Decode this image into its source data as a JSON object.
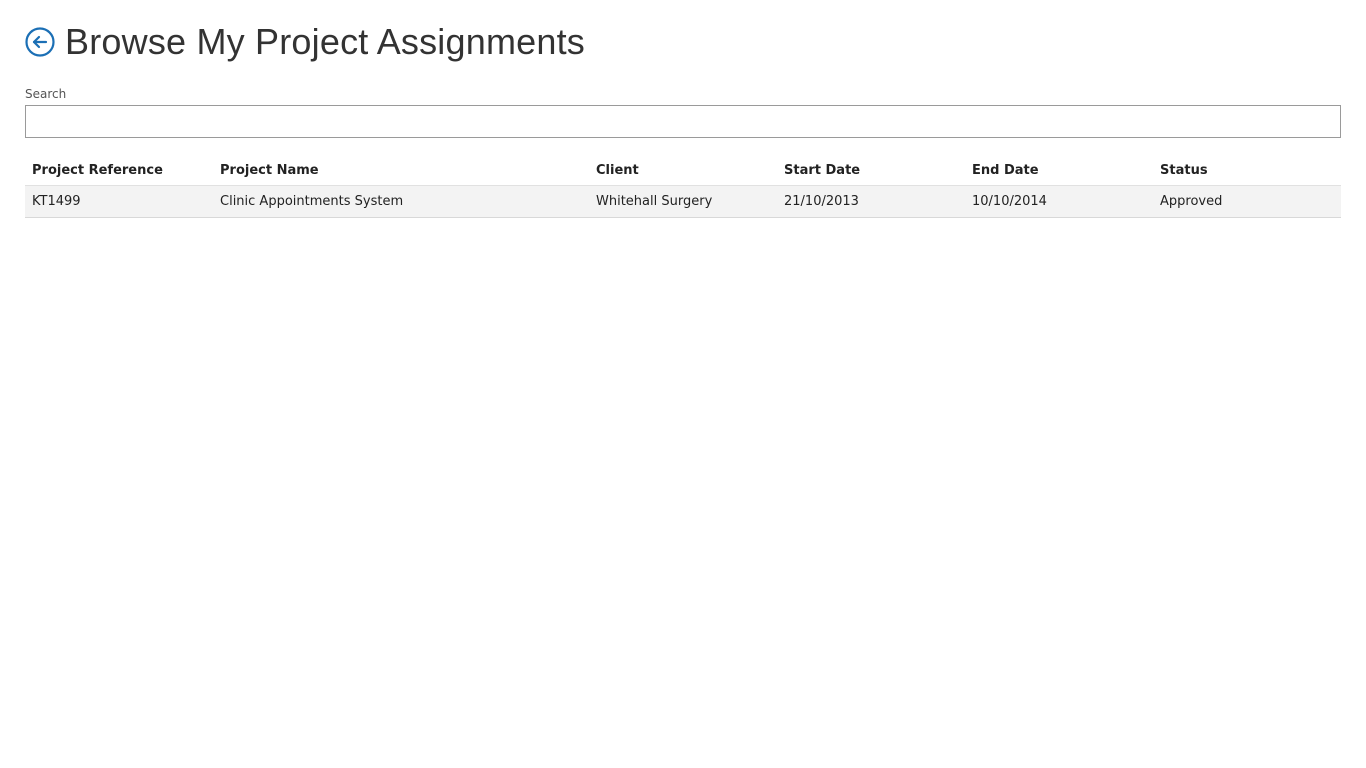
{
  "page": {
    "title": "Browse My Project Assignments",
    "back_icon": "circle-arrow-left-icon",
    "accent_color": "#1b6fb5"
  },
  "search": {
    "label": "Search",
    "value": "",
    "placeholder": ""
  },
  "table": {
    "columns": [
      "Project Reference",
      "Project Name",
      "Client",
      "Start Date",
      "End Date",
      "Status"
    ],
    "rows": [
      {
        "reference": "KT1499",
        "name": "Clinic Appointments System",
        "client": "Whitehall Surgery",
        "start_date": "21/10/2013",
        "end_date": "10/10/2014",
        "status": "Approved"
      }
    ]
  }
}
